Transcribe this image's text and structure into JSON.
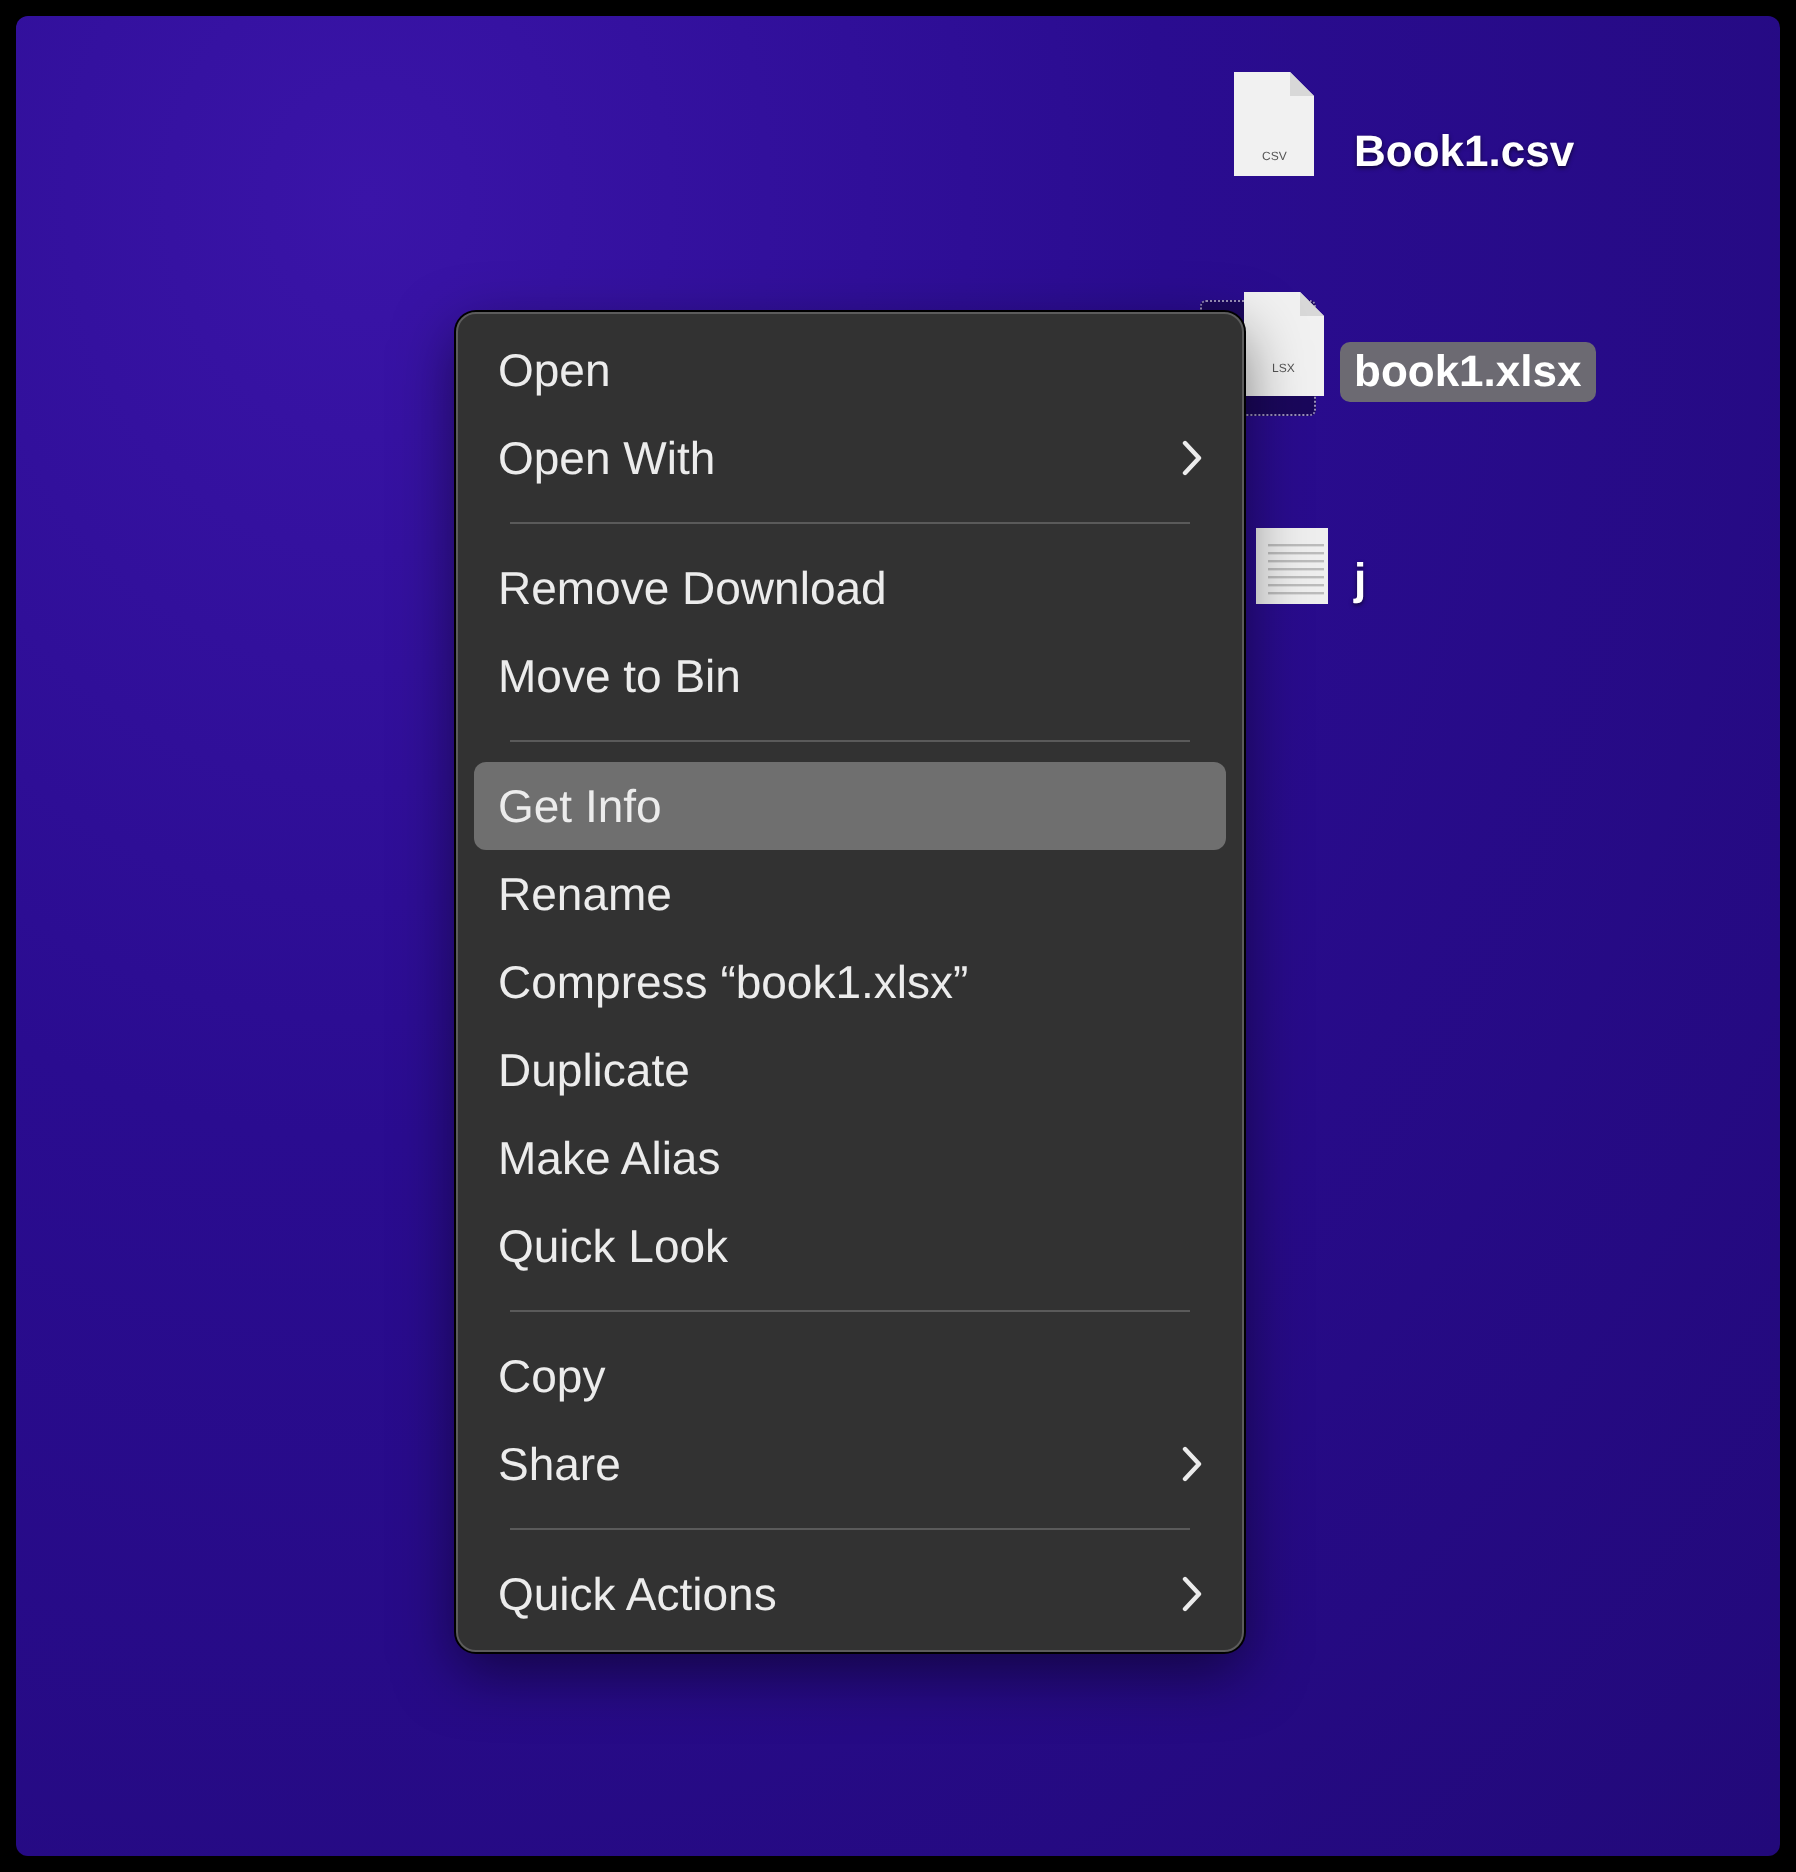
{
  "desktop": {
    "icons": [
      {
        "kind": "csv",
        "name": "Book1.csv",
        "icon_label": "CSV",
        "selected": false
      },
      {
        "kind": "sheet",
        "name": "book1.xlsx",
        "icon_label": "LSX",
        "selected": true
      },
      {
        "kind": "text",
        "name": "j",
        "selected": false
      }
    ]
  },
  "context_menu": {
    "items": [
      {
        "kind": "item",
        "label": "Open",
        "submenu": false,
        "selected": false
      },
      {
        "kind": "item",
        "label": "Open With",
        "submenu": true,
        "selected": false
      },
      {
        "kind": "separator"
      },
      {
        "kind": "item",
        "label": "Remove Download",
        "submenu": false,
        "selected": false
      },
      {
        "kind": "item",
        "label": "Move to Bin",
        "submenu": false,
        "selected": false
      },
      {
        "kind": "separator"
      },
      {
        "kind": "item",
        "label": "Get Info",
        "submenu": false,
        "selected": true
      },
      {
        "kind": "item",
        "label": "Rename",
        "submenu": false,
        "selected": false
      },
      {
        "kind": "item",
        "label": "Compress “book1.xlsx”",
        "submenu": false,
        "selected": false
      },
      {
        "kind": "item",
        "label": "Duplicate",
        "submenu": false,
        "selected": false
      },
      {
        "kind": "item",
        "label": "Make Alias",
        "submenu": false,
        "selected": false
      },
      {
        "kind": "item",
        "label": "Quick Look",
        "submenu": false,
        "selected": false
      },
      {
        "kind": "separator"
      },
      {
        "kind": "item",
        "label": "Copy",
        "submenu": false,
        "selected": false
      },
      {
        "kind": "item",
        "label": "Share",
        "submenu": true,
        "selected": false
      },
      {
        "kind": "separator"
      },
      {
        "kind": "item",
        "label": "Quick Actions",
        "submenu": true,
        "selected": false
      }
    ]
  }
}
